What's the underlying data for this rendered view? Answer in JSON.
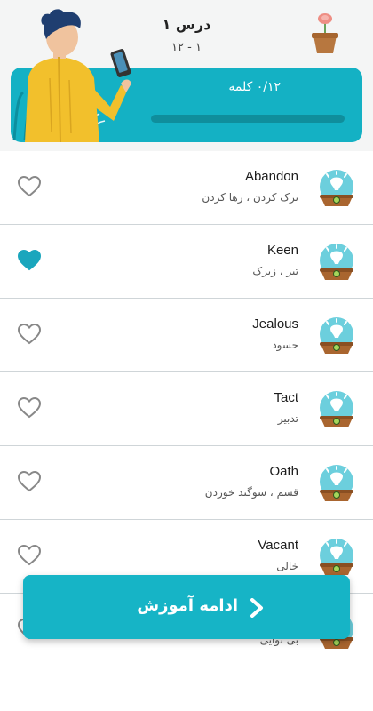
{
  "header": {
    "title": "درس ۱",
    "subtitle": "۱۲ - ۱",
    "word_count": "۰/۱۲  کلمه",
    "progress_fraction": 0.0
  },
  "words": [
    {
      "word": "Abandon",
      "meaning": "ترک کردن ، رها کردن",
      "favorite": false
    },
    {
      "word": "Keen",
      "meaning": "تیز ، زیرک",
      "favorite": true
    },
    {
      "word": "Jealous",
      "meaning": "حسود",
      "favorite": false
    },
    {
      "word": "Tact",
      "meaning": "تدبیر",
      "favorite": false
    },
    {
      "word": "Oath",
      "meaning": "قسم ، سوگند خوردن",
      "favorite": false
    },
    {
      "word": "Vacant",
      "meaning": "خالی",
      "favorite": false
    },
    {
      "word": "",
      "meaning": "بی توایی",
      "favorite": false
    }
  ],
  "continue_button": {
    "label": "ادامه آموزش"
  },
  "colors": {
    "accent": "#14b1c4",
    "heart_fill": "#1aa6bd",
    "heart_outline": "#888888"
  },
  "icons": {
    "favorite": "heart-icon",
    "next": "chevron-right-icon",
    "word": "light-bulb-icon",
    "plant": "plant-pot-icon"
  }
}
